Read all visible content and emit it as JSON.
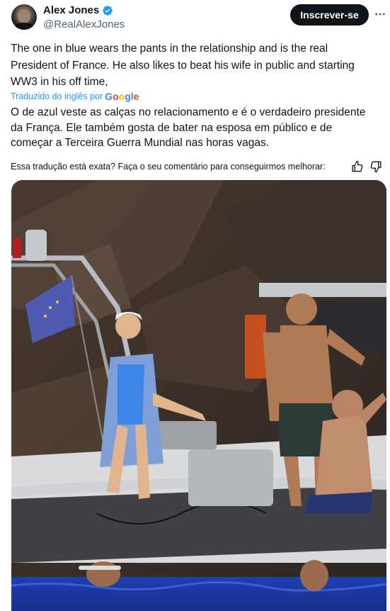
{
  "author": {
    "name": "Alex Jones",
    "handle": "@RealAlexJones",
    "avatar_icon": "profile-photo-icon",
    "verified_icon": "verified-badge-icon",
    "verified_color": "#1d9bf0"
  },
  "follow_button": {
    "label": "Inscrever-se"
  },
  "more_icon": "more-horizontal-icon",
  "tweet": {
    "text_line1": "The one in blue wears the pants in the relationship and is the real",
    "text_line2": "President of France.  He also likes to beat his wife in public and starting",
    "text_line3": "WW3 in his off time,"
  },
  "translation": {
    "source_label": "Traduzido do inglês por",
    "provider": "Google",
    "line1": "O de azul veste as calças no relacionamento e é o verdadeiro presidente",
    "line2": "da França. Ele também gosta de bater na esposa em público e de",
    "line3": "começar a Terceira Guerra Mundial nas horas vagas."
  },
  "feedback": {
    "prompt": "Essa tradução está exata? Faça o seu comentário para conseguirmos melhorar:",
    "like_icon": "thumbs-up-icon",
    "dislike_icon": "thumbs-down-icon"
  },
  "media": {
    "photo_icon": "tweet-photo"
  },
  "colors": {
    "accent": "#1d9bf0",
    "text": "#0f1419",
    "muted": "#536471",
    "button": "#0f1419"
  }
}
